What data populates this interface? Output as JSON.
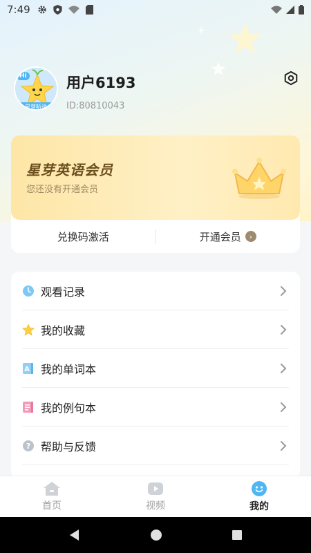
{
  "status_bar": {
    "time": "7:49",
    "left_icons": [
      "gear-icon",
      "shield-icon",
      "wifi-icon",
      "sd-card-icon"
    ],
    "right_icons": [
      "wifi-signal-icon",
      "cell-signal-icon",
      "battery-icon"
    ]
  },
  "profile": {
    "username": "用户6193",
    "user_id": "ID:80810043",
    "avatar_badge": "Hi",
    "avatar_caption": "星芽听说"
  },
  "vip": {
    "title": "星芽英语会员",
    "subtitle": "您还没有开通会员",
    "redeem_label": "兑换码激活",
    "open_label": "开通会员"
  },
  "menu": {
    "items": [
      {
        "label": "观看记录",
        "icon": "clock-icon"
      },
      {
        "label": "我的收藏",
        "icon": "star-icon"
      },
      {
        "label": "我的单词本",
        "icon": "wordbook-icon"
      },
      {
        "label": "我的例句本",
        "icon": "sentence-book-icon"
      },
      {
        "label": "帮助与反馈",
        "icon": "help-icon"
      }
    ]
  },
  "tabs": [
    {
      "label": "首页",
      "icon": "home-icon",
      "active": false
    },
    {
      "label": "视频",
      "icon": "video-icon",
      "active": false
    },
    {
      "label": "我的",
      "icon": "smiley-icon",
      "active": true
    }
  ],
  "colors": {
    "accent_blue": "#4fb6f3",
    "vip_gold": "#6b4e1e",
    "vip_bg": "#fde6a6"
  }
}
